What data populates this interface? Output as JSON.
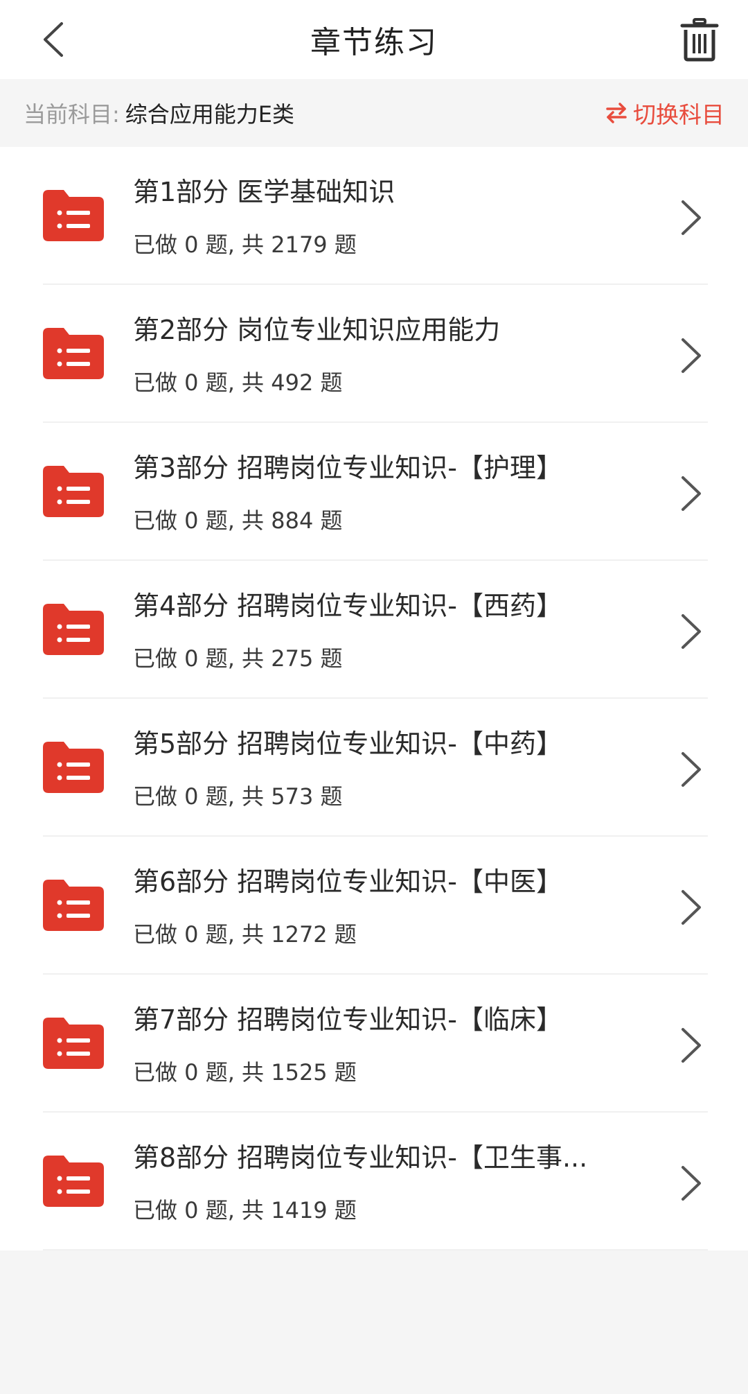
{
  "header": {
    "title": "章节练习"
  },
  "subject": {
    "label": "当前科目:",
    "name": "综合应用能力E类",
    "switch_label": "切换科目",
    "accent_color": "#e84c3d"
  },
  "items": [
    {
      "title": "第1部分 医学基础知识",
      "count": "已做 0 题, 共 2179 题"
    },
    {
      "title": "第2部分 岗位专业知识应用能力",
      "count": "已做 0 题, 共 492 题"
    },
    {
      "title": "第3部分 招聘岗位专业知识-【护理】",
      "count": "已做 0 题, 共 884 题"
    },
    {
      "title": "第4部分 招聘岗位专业知识-【西药】",
      "count": "已做 0 题, 共 275 题"
    },
    {
      "title": "第5部分 招聘岗位专业知识-【中药】",
      "count": "已做 0 题, 共 573 题"
    },
    {
      "title": "第6部分 招聘岗位专业知识-【中医】",
      "count": "已做 0 题, 共 1272 题"
    },
    {
      "title": "第7部分 招聘岗位专业知识-【临床】",
      "count": "已做 0 题, 共 1525 题"
    },
    {
      "title": "第8部分 招聘岗位专业知识-【卫生事...",
      "count": "已做 0 题, 共 1419 题"
    }
  ],
  "icons": {
    "back": "chevron-left-icon",
    "trash": "trash-icon",
    "switch": "swap-arrows-icon",
    "folder": "folder-list-icon",
    "row": "chevron-right-icon"
  }
}
